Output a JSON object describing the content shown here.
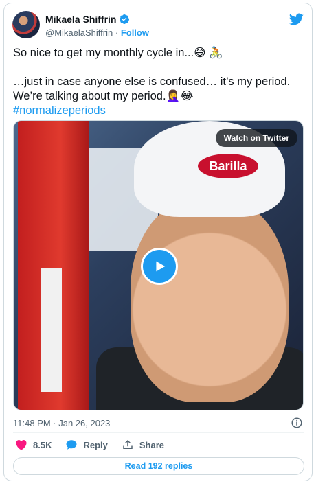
{
  "author": {
    "name": "Mikaela Shiffrin",
    "handle": "@MikaelaShiffrin",
    "separator": "·",
    "follow_label": "Follow"
  },
  "tweet": {
    "line1": "So nice to get my monthly cycle in...😅 🚴",
    "line2": "…just in case anyone else is confused… it’s my period.",
    "line3": "We’re talking about my period.🤦‍♀️😂",
    "hashtag": "#normalizeperiods"
  },
  "media": {
    "watch_label": "Watch on Twitter",
    "sign_text": "Barilla"
  },
  "meta": {
    "timestamp": "11:48 PM · Jan 26, 2023"
  },
  "actions": {
    "likes": "8.5K",
    "reply_label": "Reply",
    "share_label": "Share"
  },
  "read_replies": "Read 192 replies",
  "colors": {
    "accent": "#1d9bf0",
    "like": "#f91880",
    "text": "#0f1419",
    "muted": "#536471"
  },
  "icons": [
    "verified-badge-icon",
    "twitter-bird-icon",
    "play-icon",
    "info-icon",
    "heart-icon",
    "reply-icon",
    "share-icon"
  ]
}
